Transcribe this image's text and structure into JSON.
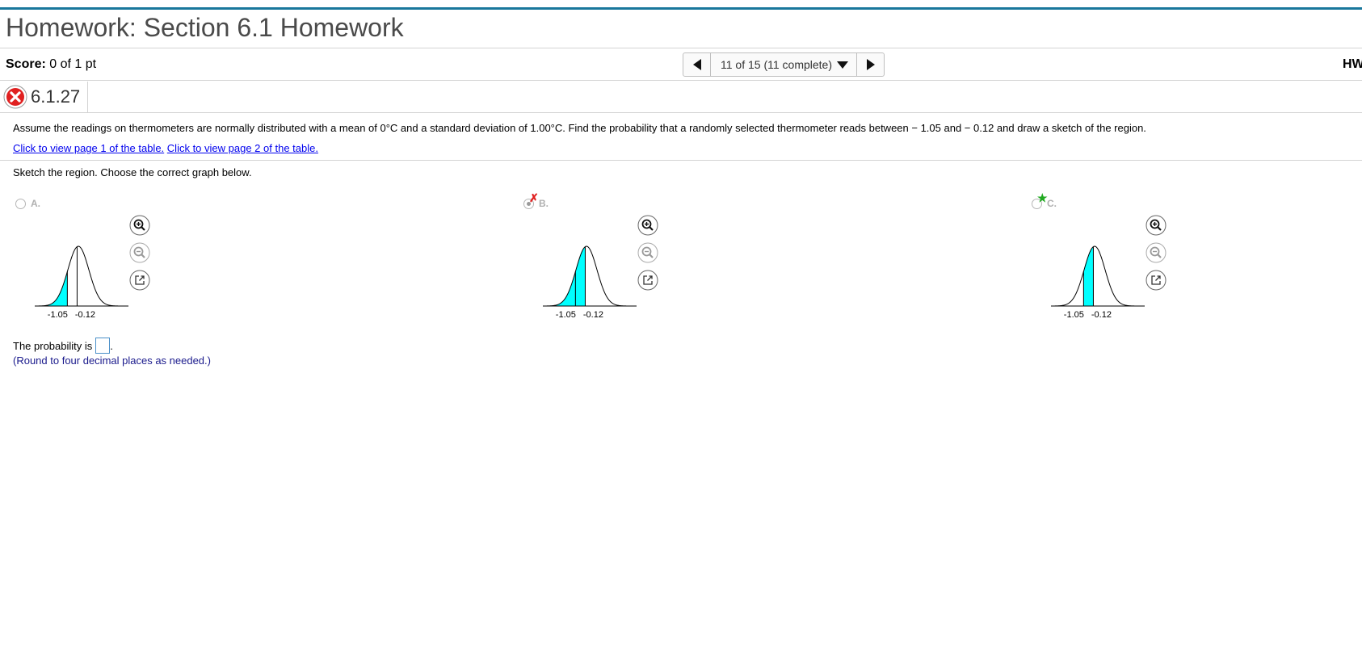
{
  "header": {
    "title": "Homework: Section 6.1 Homework",
    "score_label": "Score:",
    "score_value": "0 of 1 pt",
    "nav_status": "11 of 15 (11 complete)",
    "right_label": "HW"
  },
  "question": {
    "number": "6.1.27",
    "text": "Assume the readings on thermometers are normally distributed with a mean of 0°C and a standard deviation of 1.00°C. Find the probability that a randomly selected thermometer reads between  − 1.05 and  − 0.12 and draw a sketch of the region.",
    "link1": "Click to view page 1 of the table.",
    "link2": "Click to view page 2 of the table.",
    "sketch_prompt": "Sketch the region. Choose the correct graph below.",
    "options": [
      {
        "label": "A.",
        "tick1": "-1.05",
        "tick2": "-0.12",
        "shade": "left of -1.05",
        "selected": false,
        "mark": ""
      },
      {
        "label": "B.",
        "tick1": "-1.05",
        "tick2": "-0.12",
        "shade": "left of -0.12",
        "selected": true,
        "mark": "✗"
      },
      {
        "label": "C.",
        "tick1": "-1.05",
        "tick2": "-0.12",
        "shade": "between -1.05 and -0.12",
        "selected": false,
        "mark": "★"
      }
    ],
    "answer_prefix": "The probability is",
    "answer_suffix": ".",
    "round_note": "(Round to four decimal places as needed.)"
  },
  "colors": {
    "accent_bar": "#19779c",
    "shade": "#00ffff",
    "wrong": "#e02020",
    "correct": "#22aa22",
    "link": "#0000ee"
  },
  "icons": {
    "wrong": "x-circle-icon",
    "zoom_in": "zoom-in-icon",
    "zoom_out": "zoom-out-icon",
    "popout": "popout-icon"
  }
}
